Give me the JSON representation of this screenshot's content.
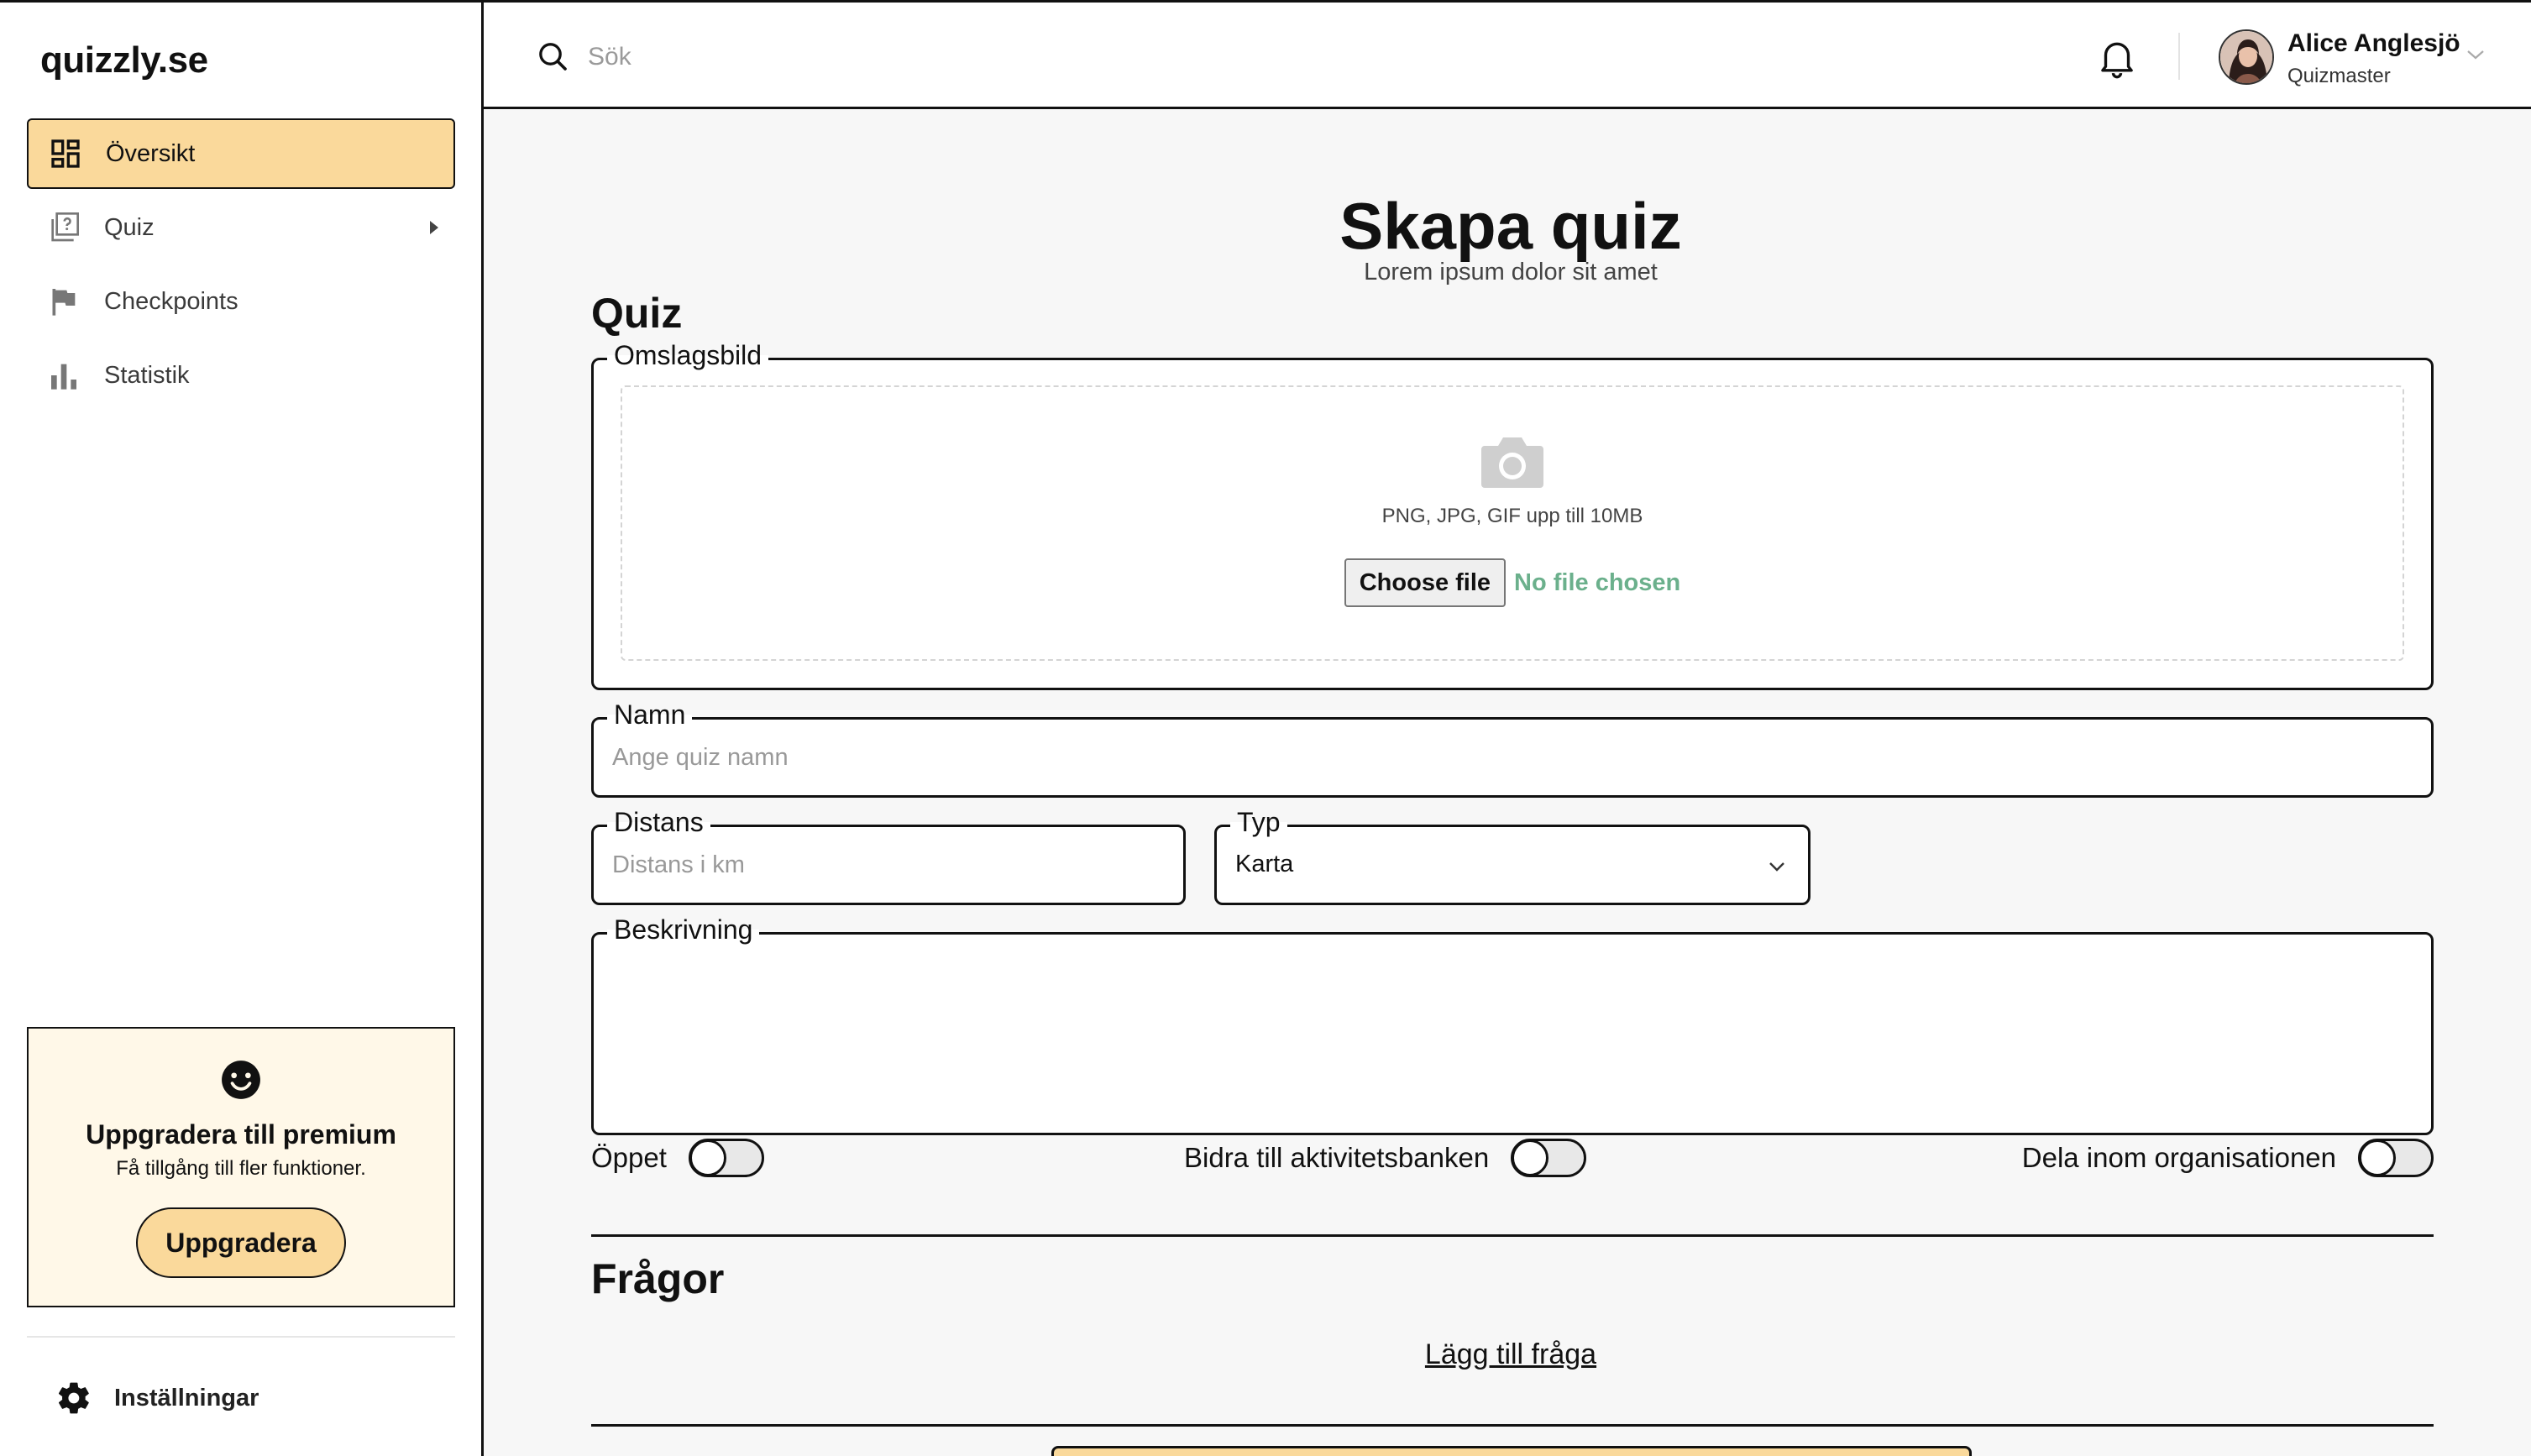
{
  "brand": "quizzly.se",
  "sidebar": {
    "items": [
      {
        "label": "Översikt",
        "icon": "dashboard-icon",
        "active": true
      },
      {
        "label": "Quiz",
        "icon": "quiz-icon",
        "has_submenu": true
      },
      {
        "label": "Checkpoints",
        "icon": "flag-icon"
      },
      {
        "label": "Statistik",
        "icon": "bar-chart-icon"
      }
    ],
    "promo": {
      "icon": "smile-icon",
      "title": "Uppgradera till premium",
      "subtitle": "Få tillgång till fler funktioner.",
      "button": "Uppgradera"
    },
    "settings_label": "Inställningar"
  },
  "topbar": {
    "search_placeholder": "Sök",
    "user": {
      "name": "Alice Anglesjö",
      "role": "Quizmaster"
    }
  },
  "page": {
    "title": "Skapa quiz",
    "subtitle": "Lorem ipsum dolor sit amet",
    "quiz_section": "Quiz",
    "cover": {
      "legend": "Omslagsbild",
      "hint": "PNG, JPG, GIF upp till 10MB",
      "choose_file": "Choose file",
      "file_status": "No file chosen"
    },
    "name": {
      "legend": "Namn",
      "placeholder": "Ange quiz namn"
    },
    "distance": {
      "legend": "Distans",
      "placeholder": "Distans i km"
    },
    "type": {
      "legend": "Typ",
      "value": "Karta"
    },
    "description": {
      "legend": "Beskrivning",
      "value": ""
    },
    "toggles": [
      {
        "label": "Öppet",
        "on": false
      },
      {
        "label": "Bidra till aktivitetsbanken",
        "on": false
      },
      {
        "label": "Dela inom organisationen",
        "on": false
      }
    ],
    "questions_section": "Frågor",
    "add_question": "Lägg till fråga"
  },
  "colors": {
    "accent": "#fad99b",
    "promo_bg": "#fff8e8",
    "file_status": "#6bb08c",
    "border": "#111111"
  }
}
